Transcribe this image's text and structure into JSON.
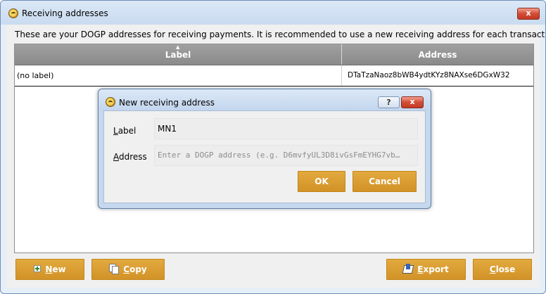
{
  "window": {
    "title": "Receiving addresses",
    "close_label": "x"
  },
  "description": "These are your DOGP addresses for receiving payments. It is recommended to use a new receiving address for each transaction.",
  "table": {
    "columns": [
      "Label",
      "Address"
    ],
    "sort_indicator": "▲",
    "rows": [
      {
        "label": "(no label)",
        "address": "DTaTzaNaoz8bWB4ydtKYz8NAXse6DGxW32"
      }
    ]
  },
  "buttons": {
    "new": {
      "mnemonic": "N",
      "rest": "ew"
    },
    "copy": {
      "mnemonic": "C",
      "rest": "opy"
    },
    "export": {
      "mnemonic": "E",
      "rest": "xport"
    },
    "close": {
      "mnemonic": "C",
      "rest": "lose"
    }
  },
  "dialog": {
    "title": "New receiving address",
    "help_label": "?",
    "close_label": "x",
    "label_field": {
      "mnemonic": "L",
      "rest": "abel",
      "value": "MN1"
    },
    "address_field": {
      "mnemonic": "A",
      "rest": "ddress",
      "placeholder": "Enter a DOGP address (e.g. D6mvfyUL3D8ivGsFmEYHG7vb…"
    },
    "ok_label": "OK",
    "cancel_label": "Cancel"
  },
  "colors": {
    "button_orange": "#d8992f",
    "header_gray": "#959595",
    "close_red": "#c8432d"
  }
}
